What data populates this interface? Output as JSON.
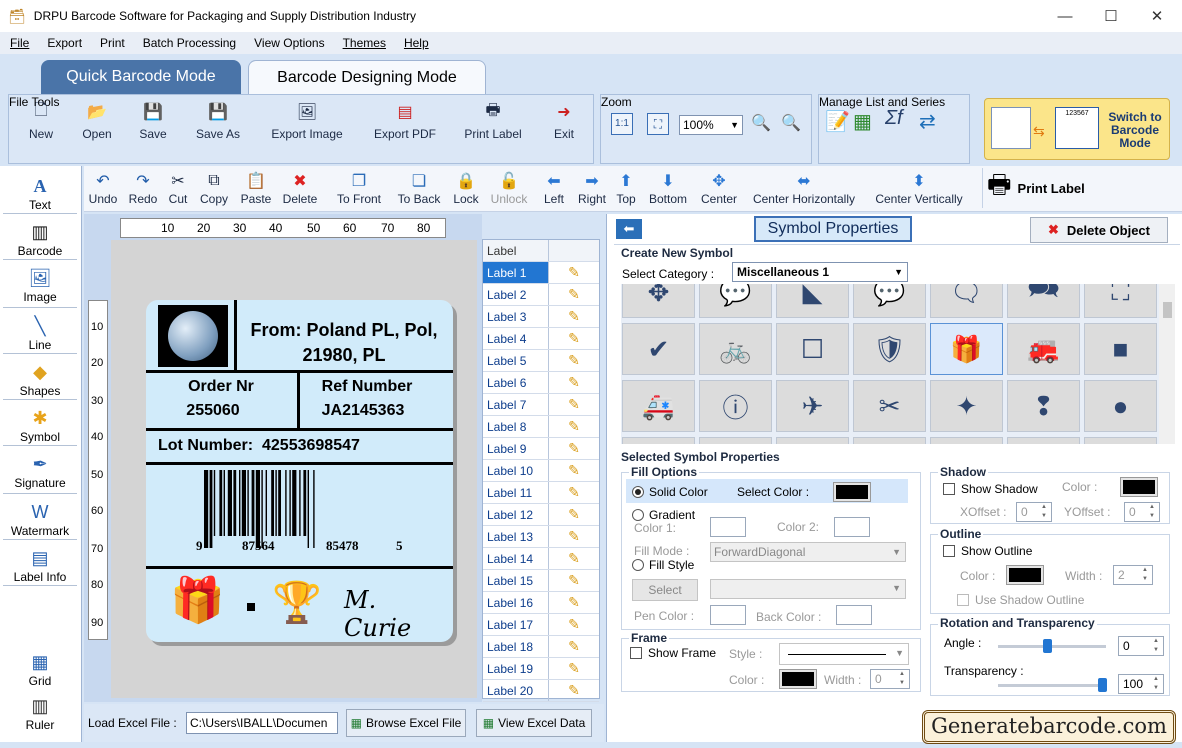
{
  "window": {
    "title": "DRPU Barcode Software for Packaging and Supply Distribution Industry",
    "minimize": "—",
    "maximize": "☐",
    "close": "✕"
  },
  "menu": [
    "File",
    "Export",
    "Print",
    "Batch Processing",
    "View Options",
    "Themes",
    "Help"
  ],
  "modes": {
    "quick": "Quick Barcode Mode",
    "design": "Barcode Designing Mode"
  },
  "file_tools": {
    "label": "File Tools",
    "buttons": [
      "New",
      "Open",
      "Save",
      "Save As",
      "Export Image",
      "Export PDF",
      "Print Label",
      "Exit"
    ]
  },
  "zoom": {
    "label": "Zoom",
    "value": "100%"
  },
  "manage": {
    "label": "Manage List and Series"
  },
  "switch": {
    "label": "Switch to Barcode Mode",
    "code": "123567"
  },
  "edit_toolbar": [
    "Undo",
    "Redo",
    "Cut",
    "Copy",
    "Paste",
    "Delete",
    "To Front",
    "To Back",
    "Lock",
    "Unlock",
    "Left",
    "Right",
    "Top",
    "Bottom",
    "Center",
    "Center Horizontally",
    "Center Vertically"
  ],
  "print_label": "Print Label",
  "left_tools": [
    "Text",
    "Barcode",
    "Image",
    "Line",
    "Shapes",
    "Symbol",
    "Signature",
    "Watermark",
    "Label Info",
    "Grid",
    "Ruler"
  ],
  "ruler_h": [
    "10",
    "20",
    "30",
    "40",
    "50",
    "60",
    "70",
    "80"
  ],
  "ruler_v": [
    "10",
    "20",
    "30",
    "40",
    "50",
    "60",
    "70",
    "80",
    "90"
  ],
  "label_card": {
    "from_line1": "From: Poland PL, Pol,",
    "from_line2": "21980, PL",
    "order_title": "Order Nr",
    "order_value": "255060",
    "ref_title": "Ref Number",
    "ref_value": "JA2145363",
    "lot_title": "Lot Number:",
    "lot_value": "42553698547",
    "barcode_digits": [
      "9",
      "87564",
      "85478",
      "5"
    ],
    "signature": "M. Curie"
  },
  "label_list": {
    "header": "Label",
    "items": [
      "Label 1",
      "Label 2",
      "Label 3",
      "Label 4",
      "Label 5",
      "Label 6",
      "Label 7",
      "Label 8",
      "Label 9",
      "Label 10",
      "Label 11",
      "Label 12",
      "Label 13",
      "Label 14",
      "Label 15",
      "Label 16",
      "Label 17",
      "Label 18",
      "Label 19",
      "Label 20"
    ],
    "selected": 0
  },
  "excel": {
    "label": "Load Excel File :",
    "path": "C:\\Users\\IBALL\\Documen",
    "browse": "Browse Excel File",
    "view": "View Excel Data"
  },
  "symbol_panel": {
    "title": "Symbol Properties",
    "delete": "Delete Object",
    "back_arrow": "⬅",
    "create_title": "Create New Symbol",
    "category_label": "Select Category :",
    "category": "Miscellaneous 1",
    "symbols": [
      "✥",
      "💬",
      "◣",
      "💬",
      "🗨",
      "🗪",
      "⛶",
      "✔",
      "🚲",
      "☐",
      "🛡",
      "🎁",
      "🚒",
      "■",
      "🚑",
      "ⓘ",
      "✈",
      "✂",
      "✦",
      "❢",
      "●"
    ],
    "selected_symbol": 11,
    "selected_title": "Selected Symbol Properties",
    "fill": {
      "title": "Fill Options",
      "solid": "Solid Color",
      "select_color": "Select Color :",
      "gradient": "Gradient",
      "color1": "Color 1:",
      "color2": "Color 2:",
      "fill_mode": "Fill Mode :",
      "fill_mode_value": "ForwardDiagonal",
      "fill_style": "Fill Style",
      "select": "Select",
      "pen_color": "Pen Color :",
      "back_color": "Back Color :"
    },
    "frame": {
      "title": "Frame",
      "show": "Show Frame",
      "style": "Style :",
      "color": "Color :",
      "width": "Width :",
      "width_value": "0"
    },
    "shadow": {
      "title": "Shadow",
      "show": "Show Shadow",
      "color": "Color :",
      "xoffset": "XOffset :",
      "xoffset_value": "0",
      "yoffset": "YOffset :",
      "yoffset_value": "0"
    },
    "outline": {
      "title": "Outline",
      "show": "Show Outline",
      "color": "Color :",
      "width": "Width :",
      "width_value": "2",
      "use_shadow": "Use Shadow Outline"
    },
    "rotation": {
      "title": "Rotation and Transparency",
      "angle": "Angle :",
      "angle_value": "0",
      "transparency": "Transparency :",
      "transparency_value": "100",
      "angle_fraction": 0.45,
      "transparency_fraction": 1.0
    }
  },
  "watermark_site": "Generatebarcode.com",
  "colors": {
    "accent": "#2276d2",
    "ribbon": "#dbe7f6",
    "label_bg": "#d1ebfa",
    "mode_active": "#4a74a8"
  }
}
